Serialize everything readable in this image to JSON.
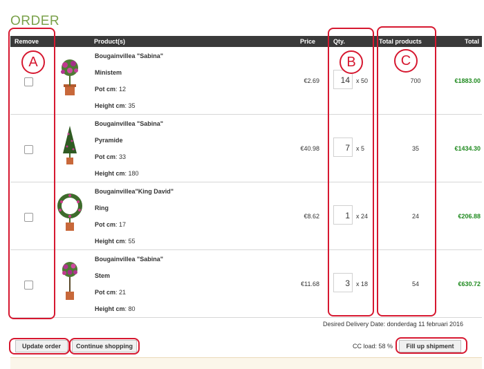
{
  "page": {
    "title": "ORDER"
  },
  "table": {
    "headers": {
      "remove": "Remove",
      "products": "Product(s)",
      "price": "Price",
      "qty": "Qty.",
      "total_products": "Total products",
      "total": "Total"
    },
    "rows": [
      {
        "name": "Bougainvillea \"Sabina\"",
        "variant": "Ministem",
        "pot_label": "Pot cm",
        "pot": ": 12",
        "height_label": "Height cm",
        "height": ": 35",
        "price": "€2.69",
        "qty": "14",
        "multiplier": "x 50",
        "total_products": "700",
        "total": "€1883.00",
        "image": "flowering-plant-image"
      },
      {
        "name": "Bougainvillea \"Sabina\"",
        "variant": "Pyramide",
        "pot_label": "Pot cm",
        "pot": ": 33",
        "height_label": "Height cm",
        "height": ": 180",
        "price": "€40.98",
        "qty": "7",
        "multiplier": "x 5",
        "total_products": "35",
        "total": "€1434.30",
        "image": "pyramid-plant-image"
      },
      {
        "name": "Bougainvillea\"King David\"",
        "variant": "Ring",
        "pot_label": "Pot cm",
        "pot": ": 17",
        "height_label": "Height cm",
        "height": ": 55",
        "price": "€8.62",
        "qty": "1",
        "multiplier": "x 24",
        "total_products": "24",
        "total": "€206.88",
        "image": "ring-plant-image"
      },
      {
        "name": "Bougainvillea \"Sabina\"",
        "variant": "Stem",
        "pot_label": "Pot cm",
        "pot": ": 21",
        "height_label": "Height cm",
        "height": ": 80",
        "price": "€11.68",
        "qty": "3",
        "multiplier": "x 18",
        "total_products": "54",
        "total": "€630.72",
        "image": "stem-plant-image"
      }
    ]
  },
  "delivery": "Desired Delivery Date: donderdag 11 februari 2016",
  "buttons": {
    "update": "Update order",
    "continue": "Continue shopping",
    "fillup": "Fill up shipment"
  },
  "cc_load": "CC load: 58 %",
  "annotations": {
    "a": "A",
    "b": "B",
    "c": "C"
  },
  "colors": {
    "accent_title": "#7aa14a",
    "header_bg": "#3a3a3a",
    "total_green": "#1f8a1f",
    "annotation_red": "#d6172f"
  }
}
